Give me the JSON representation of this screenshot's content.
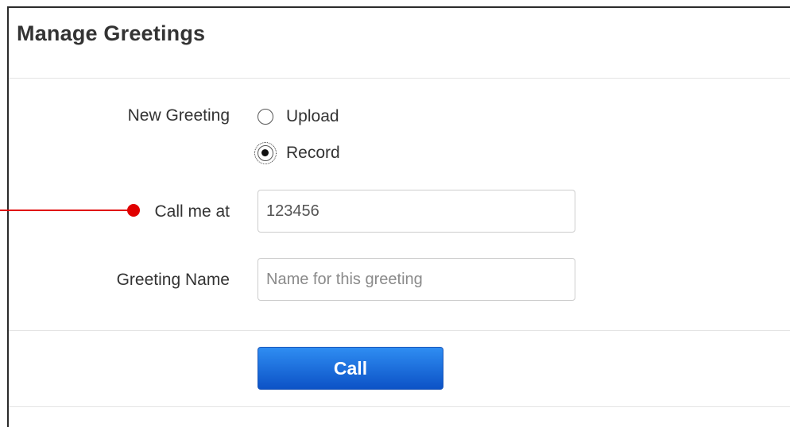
{
  "header": {
    "title": "Manage Greetings"
  },
  "form": {
    "new_greeting_label": "New Greeting",
    "options": [
      {
        "label": "Upload",
        "selected": false
      },
      {
        "label": "Record",
        "selected": true
      }
    ],
    "call_me_at_label": "Call me at",
    "call_me_at_value": "123456",
    "greeting_name_label": "Greeting Name",
    "greeting_name_placeholder": "Name for this greeting",
    "greeting_name_value": ""
  },
  "actions": {
    "call_label": "Call"
  },
  "annotation": {
    "pointer_color": "#e00000"
  },
  "colors": {
    "button_top": "#2f8df2",
    "button_bottom": "#0c52c6"
  }
}
